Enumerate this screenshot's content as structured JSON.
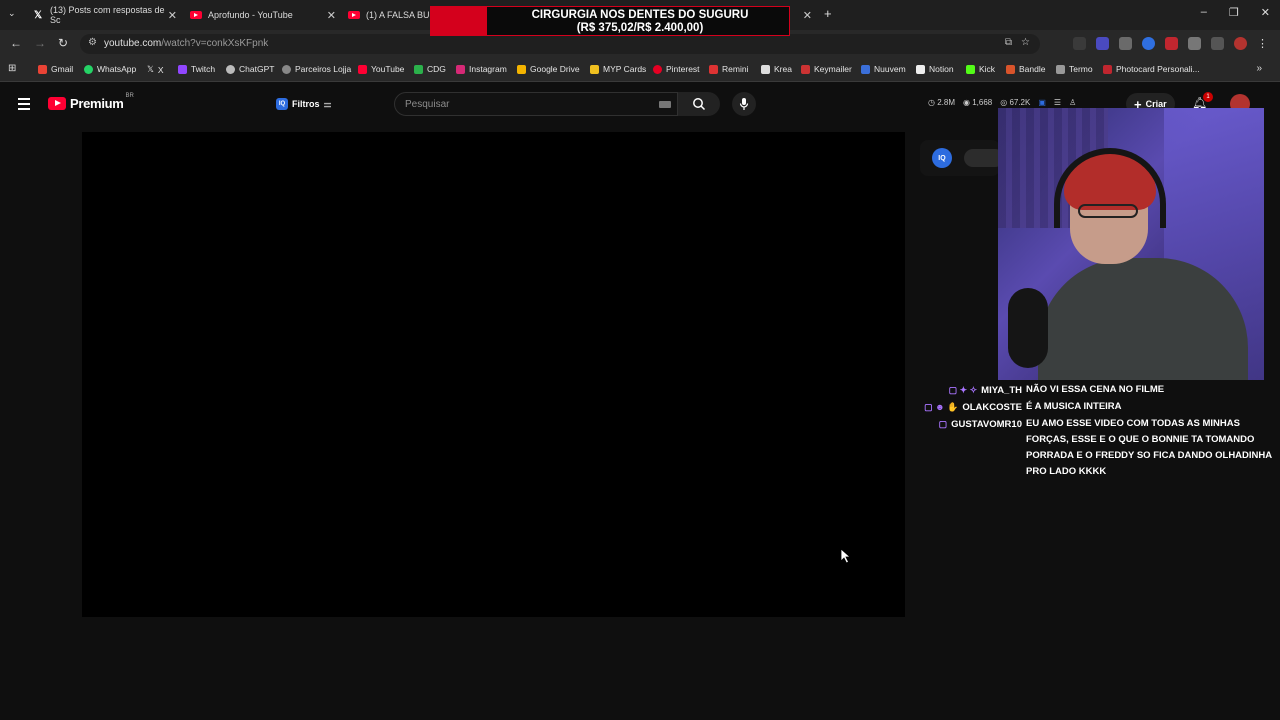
{
  "browser": {
    "tabs": [
      {
        "label": "(13) Posts com respostas de Sc",
        "icon": "x-logo-icon"
      },
      {
        "label": "Aprofundo - YouTube",
        "icon": "youtube-icon"
      },
      {
        "label": "(1) A FALSA BURR",
        "icon": "youtube-icon"
      }
    ],
    "new_tab": "+",
    "url_host": "youtube.com",
    "url_path": "/watch?v=conkXsKFpnk",
    "bookmarks": [
      "Gmail",
      "WhatsApp",
      "X",
      "Twitch",
      "ChatGPT",
      "Parceiros Lojja",
      "YouTube",
      "CDG",
      "Instagram",
      "Google Drive",
      "MYP Cards",
      "Pinterest",
      "Remini",
      "Krea",
      "Keymailer",
      "Nuuvem",
      "Notion",
      "Kick",
      "Bandle",
      "Termo",
      "Photocard Personali..."
    ]
  },
  "banner": {
    "line1": "CIRGURGIA NOS DENTES DO SUGURU",
    "line2": "(R$ 375,02/R$ 2.400,00)"
  },
  "youtube": {
    "logo_text": "Premium",
    "region": "BR",
    "filters_label": "Filtros",
    "search_placeholder": "Pesquisar",
    "stats": [
      "2.8M",
      "1,668",
      "67.2K"
    ],
    "create_label": "Criar",
    "notifications": "1"
  },
  "chat": [
    {
      "user": "MIYA_TH",
      "text": "NÃO VI ESSA CENA NO FILME"
    },
    {
      "user": "OLAKCOSTE",
      "text": "É A MUSICA INTEIRA"
    },
    {
      "user": "GUSTAVOMR10",
      "text": "EU AMO ESSE VIDEO COM TODAS AS MINHAS FORÇAS, ESSE E O QUE O BONNIE TA TOMANDO PORRADA E O FREDDY SO FICA DANDO OLHADINHA PRO LADO KKKK"
    }
  ]
}
